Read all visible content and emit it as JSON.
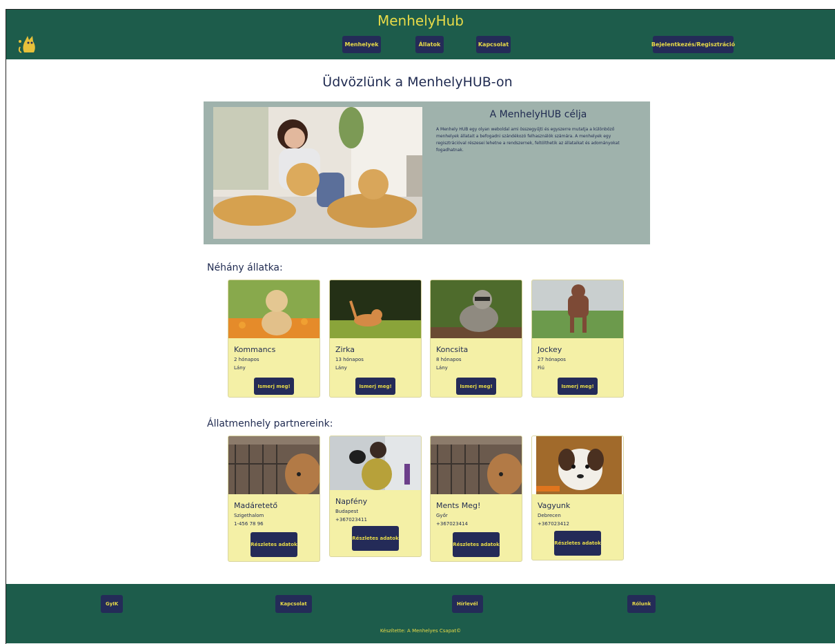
{
  "header": {
    "brand": "MenhelyHub",
    "logo_icon": "cat-logo-icon",
    "nav": [
      "Menhelyek",
      "Állatok",
      "Kapcsolat"
    ],
    "login_label": "Bejelentkezés/Regisztráció"
  },
  "welcome_title": "Üdvözlünk a MenhelyHUB-on",
  "about": {
    "title": "A MenhelyHUB célja",
    "text": "A Menhely HUB egy olyan weboldal ami összegyűjti és egyszerre mutatja a különböző menhelyek állatait a befogadni szándékozó felhasználók számára. A menhelyek egy regisztrációval részesei lehetne a rendszernek, feltölthetik az állataikat és adományokat fogadhatnak."
  },
  "animals_title": "Néhány állatka:",
  "animals": [
    {
      "name": "Kommancs",
      "age": "2 hónapos",
      "sex": "Lány",
      "button": "Ismerj meg!"
    },
    {
      "name": "Zirka",
      "age": "13 hónapos",
      "sex": "Lány",
      "button": "Ismerj meg!"
    },
    {
      "name": "Koncsita",
      "age": "8 hónapos",
      "sex": "Lány",
      "button": "Ismerj meg!"
    },
    {
      "name": "Jockey",
      "age": "27 hónapos",
      "sex": "Fiú",
      "button": "Ismerj meg!"
    }
  ],
  "partners_title": "Állatmenhely partnereink:",
  "partners": [
    {
      "name": "Madáretető",
      "city": "Szigethalom",
      "phone": "1-456 78 96",
      "button": "Részletes adatok"
    },
    {
      "name": "Napfény",
      "city": "Budapest",
      "phone": "+367023411",
      "button": "Részletes adatok"
    },
    {
      "name": "Ments Meg!",
      "city": "Győr",
      "phone": "+367023414",
      "button": "Részletes adatok"
    },
    {
      "name": "Vagyunk",
      "city": "Debrecen",
      "phone": "+367023412",
      "button": "Részletes adatok"
    }
  ],
  "footer": {
    "links": [
      "GyIK",
      "Kapcsolat",
      "Hírlevél",
      "Rólunk"
    ],
    "credit": "Készítette: A Menhelyes Csapat©"
  },
  "colors": {
    "header_bg": "#1d5c4b",
    "accent": "#e8db48",
    "button_bg": "#242b58",
    "card_bg": "#f4f0a6",
    "about_bg": "#9fb2ac"
  }
}
